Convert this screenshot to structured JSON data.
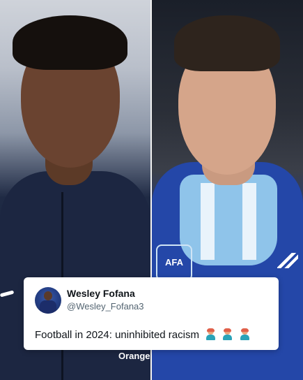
{
  "tweet": {
    "name": "Wesley Fofana",
    "handle": "@Wesley_Fofana3",
    "text": "Football in 2024: uninhibited racism",
    "emoji_count": 3,
    "emoji_icon": "person-facepalming-emoji"
  },
  "photos": {
    "left": {
      "sponsor": "Orange",
      "kit_color": "#1f2a44"
    },
    "right": {
      "crest": "AFA",
      "kit_color": "#2345a6",
      "shirt_color": "#8fc4ea"
    }
  }
}
